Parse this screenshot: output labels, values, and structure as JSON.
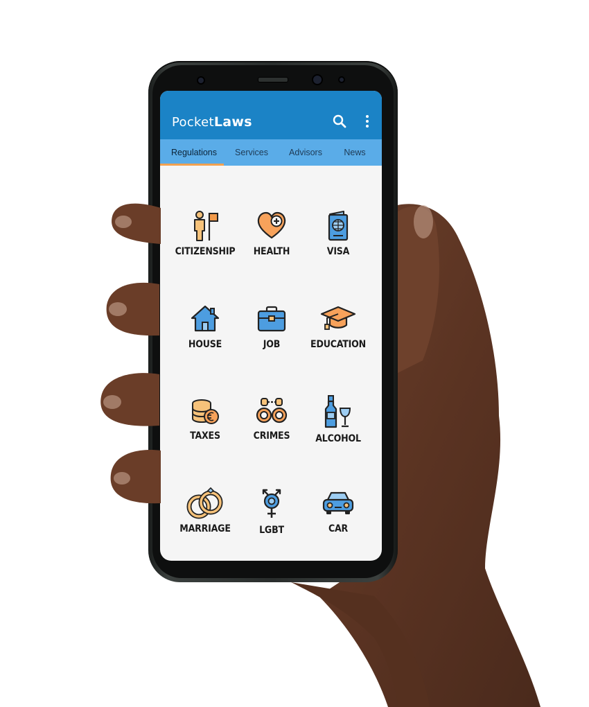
{
  "app": {
    "logo_light": "Pocket",
    "logo_bold": "Laws",
    "search_icon": "search-icon",
    "menu_icon": "more-vert-icon"
  },
  "colors": {
    "appbar": "#1b83c6",
    "tabbar": "#5aace8",
    "indicator": "#f2a150",
    "content_bg": "#f5f5f5"
  },
  "tabs": [
    {
      "label": "Regulations",
      "active": true
    },
    {
      "label": "Services",
      "active": false
    },
    {
      "label": "Advisors",
      "active": false
    },
    {
      "label": "News",
      "active": false
    }
  ],
  "categories": [
    {
      "label": "CITIZENSHIP",
      "icon": "person-flag-icon"
    },
    {
      "label": "HEALTH",
      "icon": "heart-plus-icon"
    },
    {
      "label": "VISA",
      "icon": "passport-icon"
    },
    {
      "label": "HOUSE",
      "icon": "house-icon"
    },
    {
      "label": "JOB",
      "icon": "briefcase-icon"
    },
    {
      "label": "EDUCATION",
      "icon": "graduation-cap-icon"
    },
    {
      "label": "TAXES",
      "icon": "coins-icon"
    },
    {
      "label": "CRIMES",
      "icon": "handcuffs-icon"
    },
    {
      "label": "ALCOHOL",
      "icon": "bottle-glass-icon"
    },
    {
      "label": "MARRIAGE",
      "icon": "rings-icon"
    },
    {
      "label": "LGBT",
      "icon": "gender-symbol-icon"
    },
    {
      "label": "CAR",
      "icon": "car-icon"
    }
  ]
}
